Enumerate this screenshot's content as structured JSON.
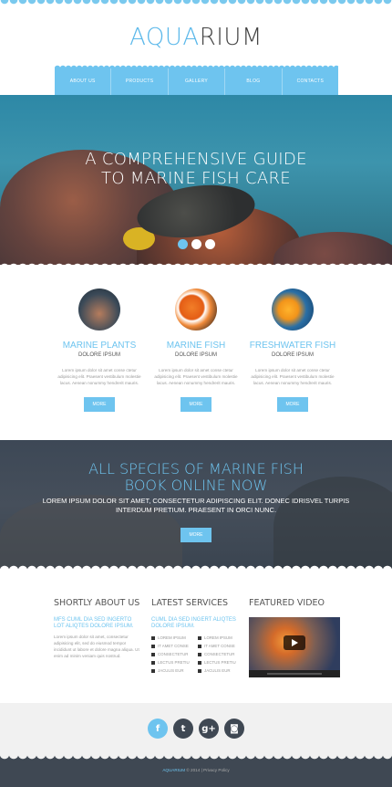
{
  "logo": {
    "part1": "AQUA",
    "part2": "RIUM"
  },
  "nav": [
    "About us",
    "Products",
    "Gallery",
    "Blog",
    "Contacts"
  ],
  "hero": {
    "title_line1": "A COMPREHENSIVE GUIDE",
    "title_line2": "TO MARINE FISH CARE",
    "slides": 3,
    "active_slide": 1
  },
  "features": [
    {
      "title": "MARINE PLANTS",
      "subtitle": "DOLORE IPSUM",
      "text": "Lorem ipsum dolor sit amet conse ctetur adipisicing elit. Praesent vestibulum molestie lacus. Aenean nonummy hendrerit mauris.",
      "button": "more",
      "image": "marine-plants"
    },
    {
      "title": "MARINE FISH",
      "subtitle": "DOLORE IPSUM",
      "text": "Lorem ipsum dolor sit amet conse ctetur adipisicing elit. Praesent vestibulum molestie lacus. Aenean nonummy hendrerit mauris.",
      "button": "more",
      "image": "clownfish"
    },
    {
      "title": "FRESHWATER FISH",
      "subtitle": "DOLORE IPSUM",
      "text": "Lorem ipsum dolor sit amet conse ctetur adipisicing elit. Praesent vestibulum molestie lacus. Aenean nonummy hendrerit mauris.",
      "button": "more",
      "image": "goldfish"
    }
  ],
  "banner": {
    "title_line1": "ALL SPECIES OF MARINE FISH",
    "title_line2": "BOOK ONLINE NOW",
    "text": "LOREM IPSUM DOLOR SIT AMET, CONSECTETUR ADIPISCING ELIT. DONEC IDRISVEL TURPIS INTERDUM PRETIUM. PRAESENT IN ORCI NUNC.",
    "button": "more"
  },
  "about": {
    "heading": "SHORTLY ABOUT US",
    "lead": "MFS CUML DIA SED INGERTO LOT ALIQTES DOLORE IPSUM.",
    "text": "Lorem ipsum dolor sit amet, consectetur adipisicing elit, sed do eiusmod tempor incididunt ut labore et dolore magna aliqua. Ut enim ad minim veniam quis nostrud."
  },
  "services": {
    "heading": "LATEST SERVICES",
    "lead": "CUML DIA SED INGERT ALIQTES DOLORE IPSUM.",
    "left": [
      "LOREM IPSUM",
      "IT AMET CONSE",
      "CONSECTETUR",
      "LECTUS PRETIU",
      "JACULIS EUR"
    ],
    "right": [
      "LOREM IPSUM",
      "IT AMET CONSE",
      "CONSECTETUR",
      "LECTUS PRETIU",
      "JACULIS EUR"
    ]
  },
  "video": {
    "heading": "FEATURED VIDEO"
  },
  "social": [
    {
      "icon": "facebook-icon",
      "glyph": "f"
    },
    {
      "icon": "twitter-icon",
      "glyph": "t"
    },
    {
      "icon": "google-plus-icon",
      "glyph": "g+"
    },
    {
      "icon": "instagram-icon",
      "glyph": "◙"
    }
  ],
  "footer": {
    "brand": "AQUARIUM",
    "copy": "© 2014",
    "sep": "|",
    "policy": "Privacy Policy"
  },
  "colors": {
    "accent": "#6ec4ef",
    "dark": "#3f4853"
  }
}
